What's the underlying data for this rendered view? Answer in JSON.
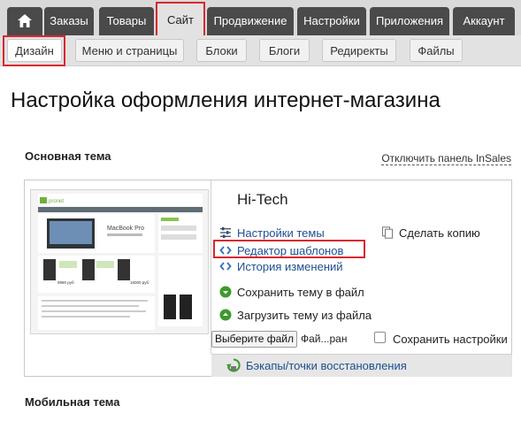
{
  "topnav": {
    "home_icon": "home-icon",
    "tabs": [
      {
        "label": "Заказы"
      },
      {
        "label": "Товары"
      },
      {
        "label": "Сайт",
        "active": true
      },
      {
        "label": "Продвижение"
      },
      {
        "label": "Настройки"
      },
      {
        "label": "Приложения"
      },
      {
        "label": "Аккаунт"
      }
    ]
  },
  "subnav": {
    "tabs": [
      {
        "label": "Дизайн",
        "active": true
      },
      {
        "label": "Меню и страницы"
      },
      {
        "label": "Блоки"
      },
      {
        "label": "Блоги"
      },
      {
        "label": "Редиректы"
      },
      {
        "label": "Файлы"
      }
    ]
  },
  "page": {
    "title": "Настройка оформления интернет-магазина",
    "main_theme_title": "Основная тема",
    "disable_panel_link": "Отключить панель InSales",
    "mobile_theme_title": "Мобильная тема"
  },
  "theme": {
    "name": "Hi-Tech",
    "preview": {
      "logo": "pronet",
      "banner_title": "MacBook Pro",
      "price1": "9990 руб",
      "price2": "15000 руб"
    },
    "actions": {
      "settings": "Настройки темы",
      "template_editor": "Редактор шаблонов",
      "history": "История изменений",
      "make_copy": "Сделать копию",
      "save_to_file": "Сохранить тему в файл",
      "load_from_file": "Загрузить тему из файла"
    },
    "file_input": {
      "button_label": "Выберите файл",
      "file_name": "Фай...ран"
    },
    "keep_settings": {
      "label": "Сохранить настройки",
      "checked": false
    },
    "backups_link": "Бэкапы/точки восстановления"
  },
  "colors": {
    "nav_tab": "#4a4a4a",
    "link": "#1d4f91",
    "highlight": "#d9272e",
    "green_icon": "#3d9a2b"
  }
}
